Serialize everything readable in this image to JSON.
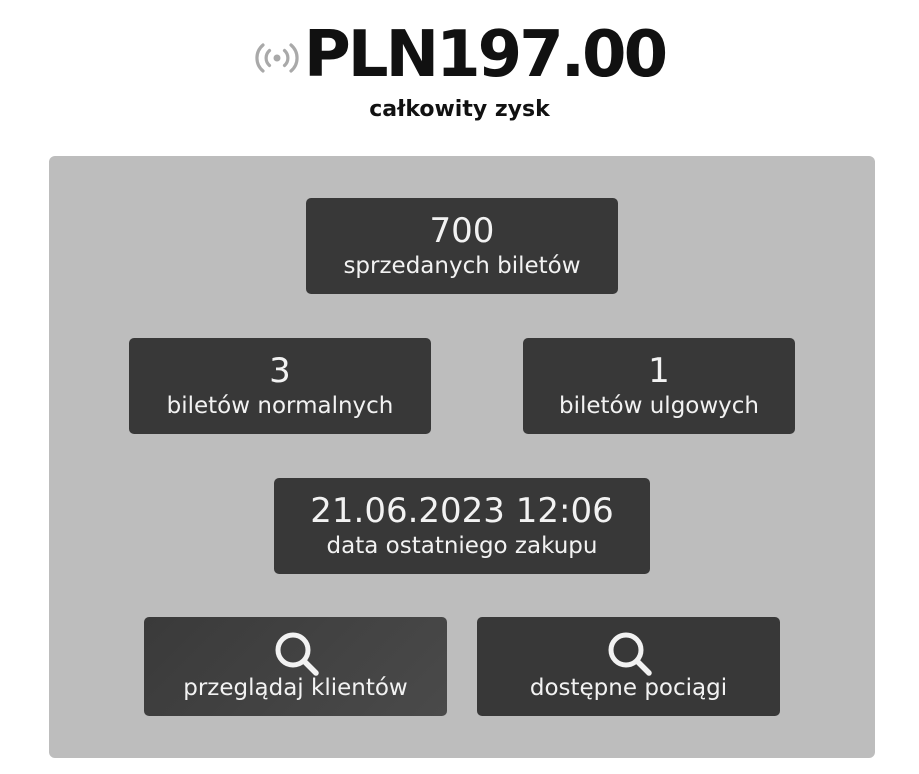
{
  "header": {
    "total_amount": "PLN197.00",
    "total_caption": "całkowity zysk",
    "status_icon": "broadcast-signal-icon"
  },
  "stats": {
    "tickets_sold": {
      "value": "700",
      "label": "sprzedanych biletów"
    },
    "normal_tickets": {
      "value": "3",
      "label": "biletów normalnych"
    },
    "reduced_tickets": {
      "value": "1",
      "label": "biletów ulgowych"
    },
    "last_purchase": {
      "value": "21.06.2023 12:06",
      "label": "data ostatniego zakupu"
    }
  },
  "actions": {
    "browse_clients": {
      "label": "przeglądaj klientów",
      "icon": "search-icon"
    },
    "available_trains": {
      "label": "dostępne pociągi",
      "icon": "search-icon"
    }
  },
  "colors": {
    "panel_background": "#bdbdbd",
    "card_background": "#383838",
    "card_text": "#f2f2f2",
    "heading_text": "#111111",
    "signal_icon": "#a9a9a9"
  }
}
